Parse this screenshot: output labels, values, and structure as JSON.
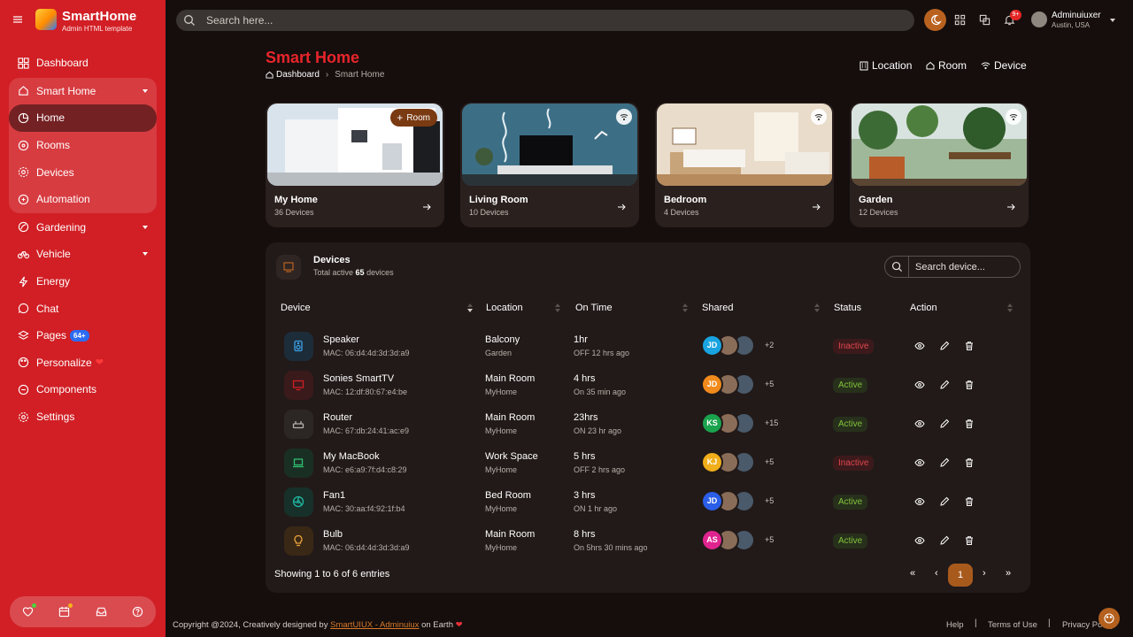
{
  "brand": {
    "name": "SmartHome",
    "subtitle": "Admin HTML template"
  },
  "sidebar": {
    "items": [
      {
        "label": "Dashboard",
        "icon": "grid-icon"
      },
      {
        "label": "Smart Home",
        "icon": "home-icon"
      },
      {
        "label": "Home",
        "icon": "pie-icon"
      },
      {
        "label": "Rooms",
        "icon": "circle-dots-icon"
      },
      {
        "label": "Devices",
        "icon": "gear-icon"
      },
      {
        "label": "Automation",
        "icon": "automation-icon"
      },
      {
        "label": "Gardening",
        "icon": "leaf-icon"
      },
      {
        "label": "Vehicle",
        "icon": "bicycle-icon"
      },
      {
        "label": "Energy",
        "icon": "bolt-icon"
      },
      {
        "label": "Chat",
        "icon": "chat-icon"
      },
      {
        "label": "Pages",
        "icon": "layers-icon",
        "badge": "64+"
      },
      {
        "label": "Personalize",
        "icon": "palette-icon"
      },
      {
        "label": "Components",
        "icon": "components-icon"
      },
      {
        "label": "Settings",
        "icon": "settings-icon"
      }
    ]
  },
  "topbar": {
    "search_placeholder": "Search here...",
    "notif_badge": "9+",
    "user": {
      "name": "Adminuiuxer",
      "location": "Austin, USA"
    }
  },
  "page": {
    "title": "Smart Home",
    "breadcrumb": [
      "Dashboard",
      "Smart Home"
    ],
    "actions": [
      "Location",
      "Room",
      "Device"
    ]
  },
  "rooms": [
    {
      "name": "My Home",
      "count": "36 Devices",
      "pill": "Room"
    },
    {
      "name": "Living Room",
      "count": "10 Devices"
    },
    {
      "name": "Bedroom",
      "count": "4 Devices"
    },
    {
      "name": "Garden",
      "count": "12 Devices"
    }
  ],
  "devices": {
    "title": "Devices",
    "subtitle_prefix": "Total active",
    "subtitle_count": "65",
    "subtitle_suffix": "devices",
    "search_placeholder": "Search device...",
    "columns": [
      "Device",
      "Location",
      "On Time",
      "Shared",
      "Status",
      "Action"
    ],
    "rows": [
      {
        "name": "Speaker",
        "mac": "MAC: 06:d4:4d:3d:3d:a9",
        "loc": "Balcony",
        "sub": "Garden",
        "time": "1hr",
        "ago": "OFF 12 hrs ago",
        "initials": "JD",
        "more": "+2",
        "status": "Inactive",
        "icon": "speaker-icon"
      },
      {
        "name": "Sonies SmartTV",
        "mac": "MAC: 12:df:80:67:e4:be",
        "loc": "Main Room",
        "sub": "MyHome",
        "time": "4 hrs",
        "ago": "On 35 min ago",
        "initials": "JD",
        "more": "+5",
        "status": "Active",
        "icon": "tv-icon"
      },
      {
        "name": "Router",
        "mac": "MAC: 67:db:24:41:ac:e9",
        "loc": "Main Room",
        "sub": "MyHome",
        "time": "23hrs",
        "ago": "ON 23 hr ago",
        "initials": "KS",
        "more": "+15",
        "status": "Active",
        "icon": "router-icon"
      },
      {
        "name": "My MacBook",
        "mac": "MAC: e6:a9:7f:d4:c8:29",
        "loc": "Work Space",
        "sub": "MyHome",
        "time": "5 hrs",
        "ago": "OFF 2 hrs ago",
        "initials": "KJ",
        "more": "+5",
        "status": "Inactive",
        "icon": "laptop-icon"
      },
      {
        "name": "Fan1",
        "mac": "MAC: 30:aa:f4:92:1f:b4",
        "loc": "Bed Room",
        "sub": "MyHome",
        "time": "3 hrs",
        "ago": "ON 1 hr ago",
        "initials": "JD",
        "more": "+5",
        "status": "Active",
        "icon": "fan-icon"
      },
      {
        "name": "Bulb",
        "mac": "MAC: 06:d4:4d:3d:3d:a9",
        "loc": "Main Room",
        "sub": "MyHome",
        "time": "8 hrs",
        "ago": "On 5hrs 30 mins ago",
        "initials": "AS",
        "more": "+5",
        "status": "Active",
        "icon": "bulb-icon"
      }
    ],
    "showing": "Showing 1 to 6 of 6 entries",
    "pagination": {
      "first": "«",
      "prev": "‹",
      "current": "1",
      "next": "›",
      "last": "»"
    }
  },
  "footer": {
    "copy_prefix": "Copyright @2024, Creatively designed by",
    "copy_link": "SmartUIUX - Adminuiux",
    "copy_suffix": "on Earth",
    "links": [
      "Help",
      "Terms of Use",
      "Privacy Policy"
    ],
    "sep": "|"
  },
  "colors": {
    "sidebar": "#d11f25",
    "accent": "#b9621f",
    "title": "#e8252b",
    "active": "#82c23b",
    "inactive": "#e0464d"
  }
}
